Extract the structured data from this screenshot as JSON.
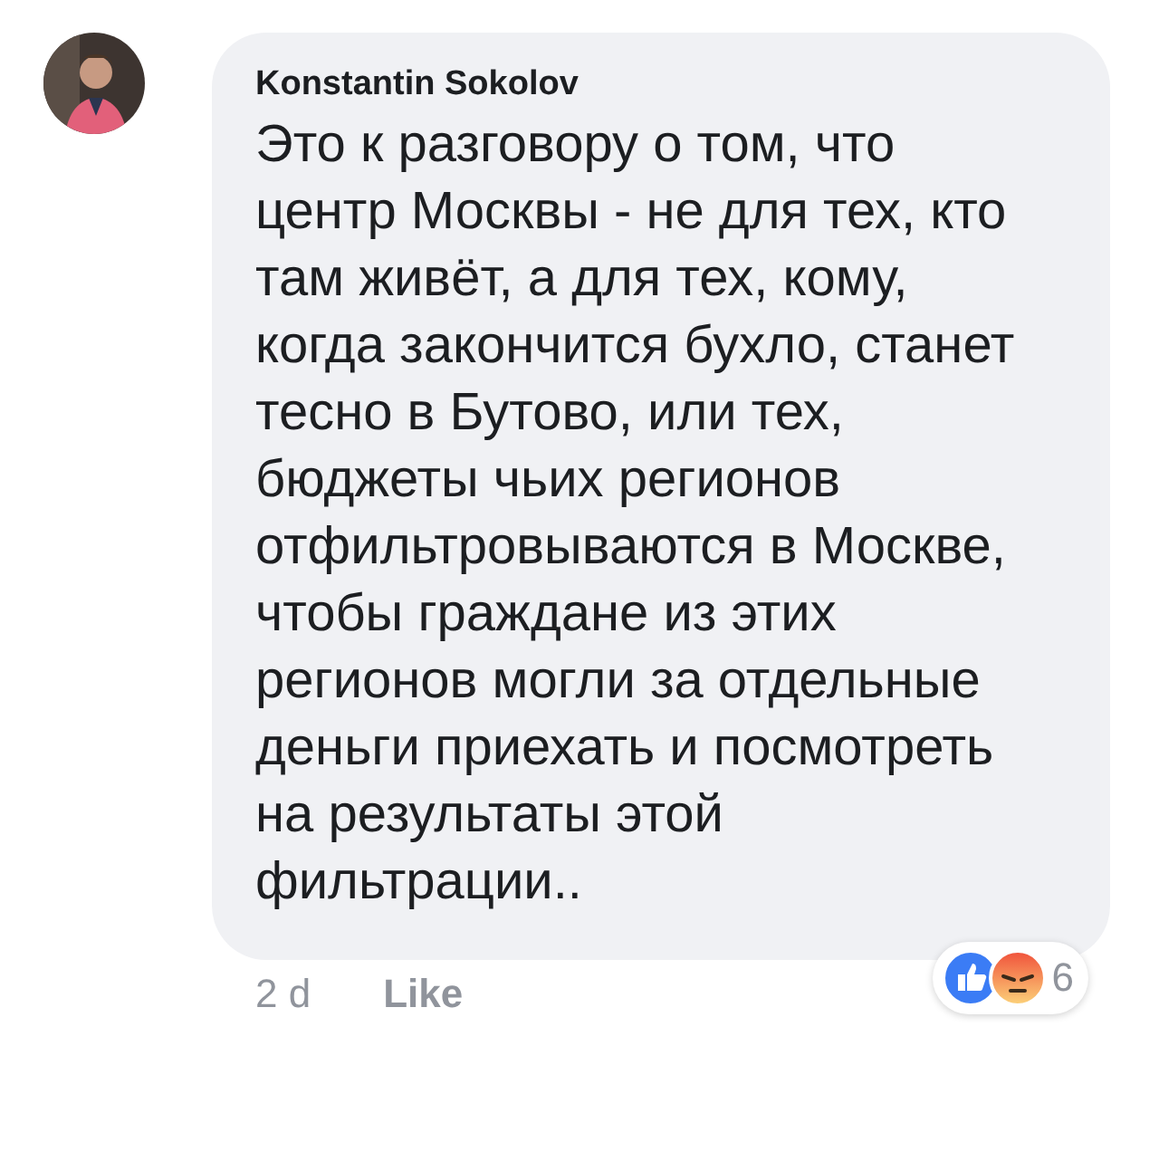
{
  "comment": {
    "author": "Konstantin Sokolov",
    "text": "Это к разговору о том, что центр Москвы - не для тех, кто там живёт, а для тех, кому, когда закончится бухло, станет тесно в Бутово, или тех, бюджеты чьих регионов отфильтровываются в Москве, чтобы граждане из этих регионов могли за отдельные деньги приехать и посмотреть на результаты этой фильтрации..",
    "time": "2 d",
    "actions": [
      {
        "label": "Like"
      }
    ],
    "reactions": {
      "types": [
        {
          "kind": "like"
        },
        {
          "kind": "angry"
        }
      ],
      "count": "6"
    }
  }
}
